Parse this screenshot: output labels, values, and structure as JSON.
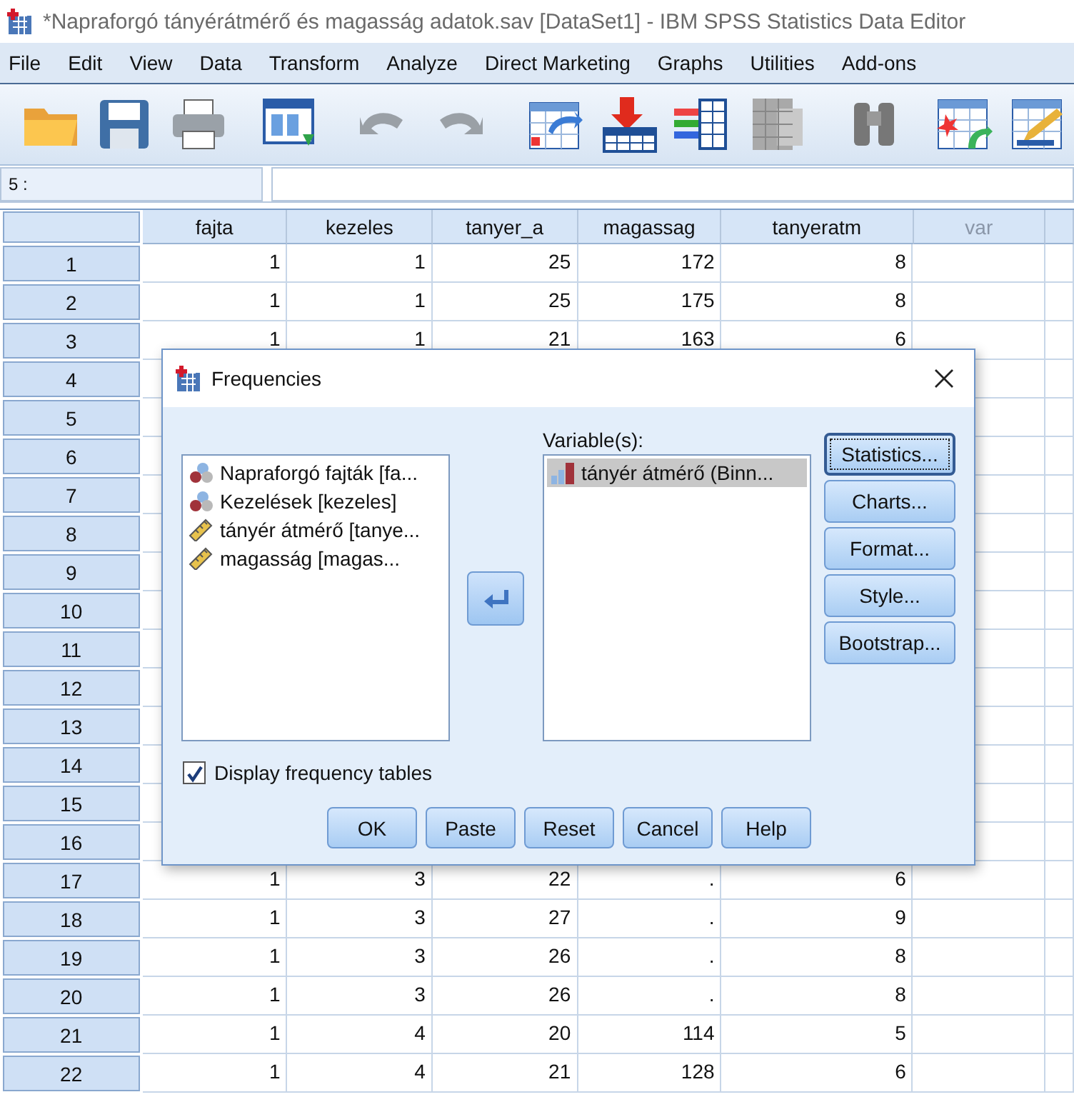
{
  "window": {
    "title": "*Napraforgó tányérátmérő és magasság adatok.sav [DataSet1] - IBM SPSS Statistics Data Editor"
  },
  "menu": [
    "File",
    "Edit",
    "View",
    "Data",
    "Transform",
    "Analyze",
    "Direct Marketing",
    "Graphs",
    "Utilities",
    "Add-ons"
  ],
  "cell_reference": {
    "label": "5 :"
  },
  "table": {
    "columns": [
      {
        "label": "fajta",
        "kind": "variable"
      },
      {
        "label": "kezeles",
        "kind": "variable"
      },
      {
        "label": "tanyer_a",
        "kind": "variable"
      },
      {
        "label": "magassag",
        "kind": "variable"
      },
      {
        "label": "tanyeratm",
        "kind": "variable"
      },
      {
        "label": "var",
        "kind": "empty"
      }
    ],
    "rows": [
      {
        "number": "1",
        "cells": [
          "1",
          "1",
          "25",
          "172",
          "8"
        ]
      },
      {
        "number": "2",
        "cells": [
          "1",
          "1",
          "25",
          "175",
          "8"
        ]
      },
      {
        "number": "3",
        "cells": [
          "1",
          "1",
          "21",
          "163",
          "6"
        ]
      },
      {
        "number": "4"
      },
      {
        "number": "5"
      },
      {
        "number": "6"
      },
      {
        "number": "7"
      },
      {
        "number": "8"
      },
      {
        "number": "9"
      },
      {
        "number": "10"
      },
      {
        "number": "11"
      },
      {
        "number": "12"
      },
      {
        "number": "13"
      },
      {
        "number": "14"
      },
      {
        "number": "15"
      },
      {
        "number": "16"
      },
      {
        "number": "17",
        "cells": [
          "1",
          "3",
          "22",
          ".",
          "6"
        ]
      },
      {
        "number": "18",
        "cells": [
          "1",
          "3",
          "27",
          ".",
          "9"
        ]
      },
      {
        "number": "19",
        "cells": [
          "1",
          "3",
          "26",
          ".",
          "8"
        ]
      },
      {
        "number": "20",
        "cells": [
          "1",
          "3",
          "26",
          ".",
          "8"
        ]
      },
      {
        "number": "21",
        "cells": [
          "1",
          "4",
          "20",
          "114",
          "5"
        ]
      },
      {
        "number": "22",
        "cells": [
          "1",
          "4",
          "21",
          "128",
          "6"
        ]
      }
    ]
  },
  "dialog": {
    "title": "Frequencies",
    "source_list": [
      {
        "label": "Napraforgó fajták [fa...",
        "kind": "nominal",
        "selected": false
      },
      {
        "label": "Kezelések [kezeles]",
        "kind": "nominal",
        "selected": false
      },
      {
        "label": "tányér átmérő [tanye...",
        "kind": "scale",
        "selected": false
      },
      {
        "label": "magasság [magas...",
        "kind": "scale",
        "selected": false
      }
    ],
    "target_label": "Variable(s):",
    "target_list": [
      {
        "label": "tányér átmérő (Binn...",
        "kind": "ordinal",
        "selected": true
      }
    ],
    "side_buttons": [
      {
        "label": "Statistics...",
        "focused": true
      },
      {
        "label": "Charts...",
        "focused": false
      },
      {
        "label": "Format...",
        "focused": false
      },
      {
        "label": "Style...",
        "focused": false
      },
      {
        "label": "Bootstrap...",
        "focused": false
      }
    ],
    "display_frequency_tables": {
      "label": "Display frequency tables",
      "checked": true
    },
    "buttons": [
      "OK",
      "Paste",
      "Reset",
      "Cancel",
      "Help"
    ]
  }
}
